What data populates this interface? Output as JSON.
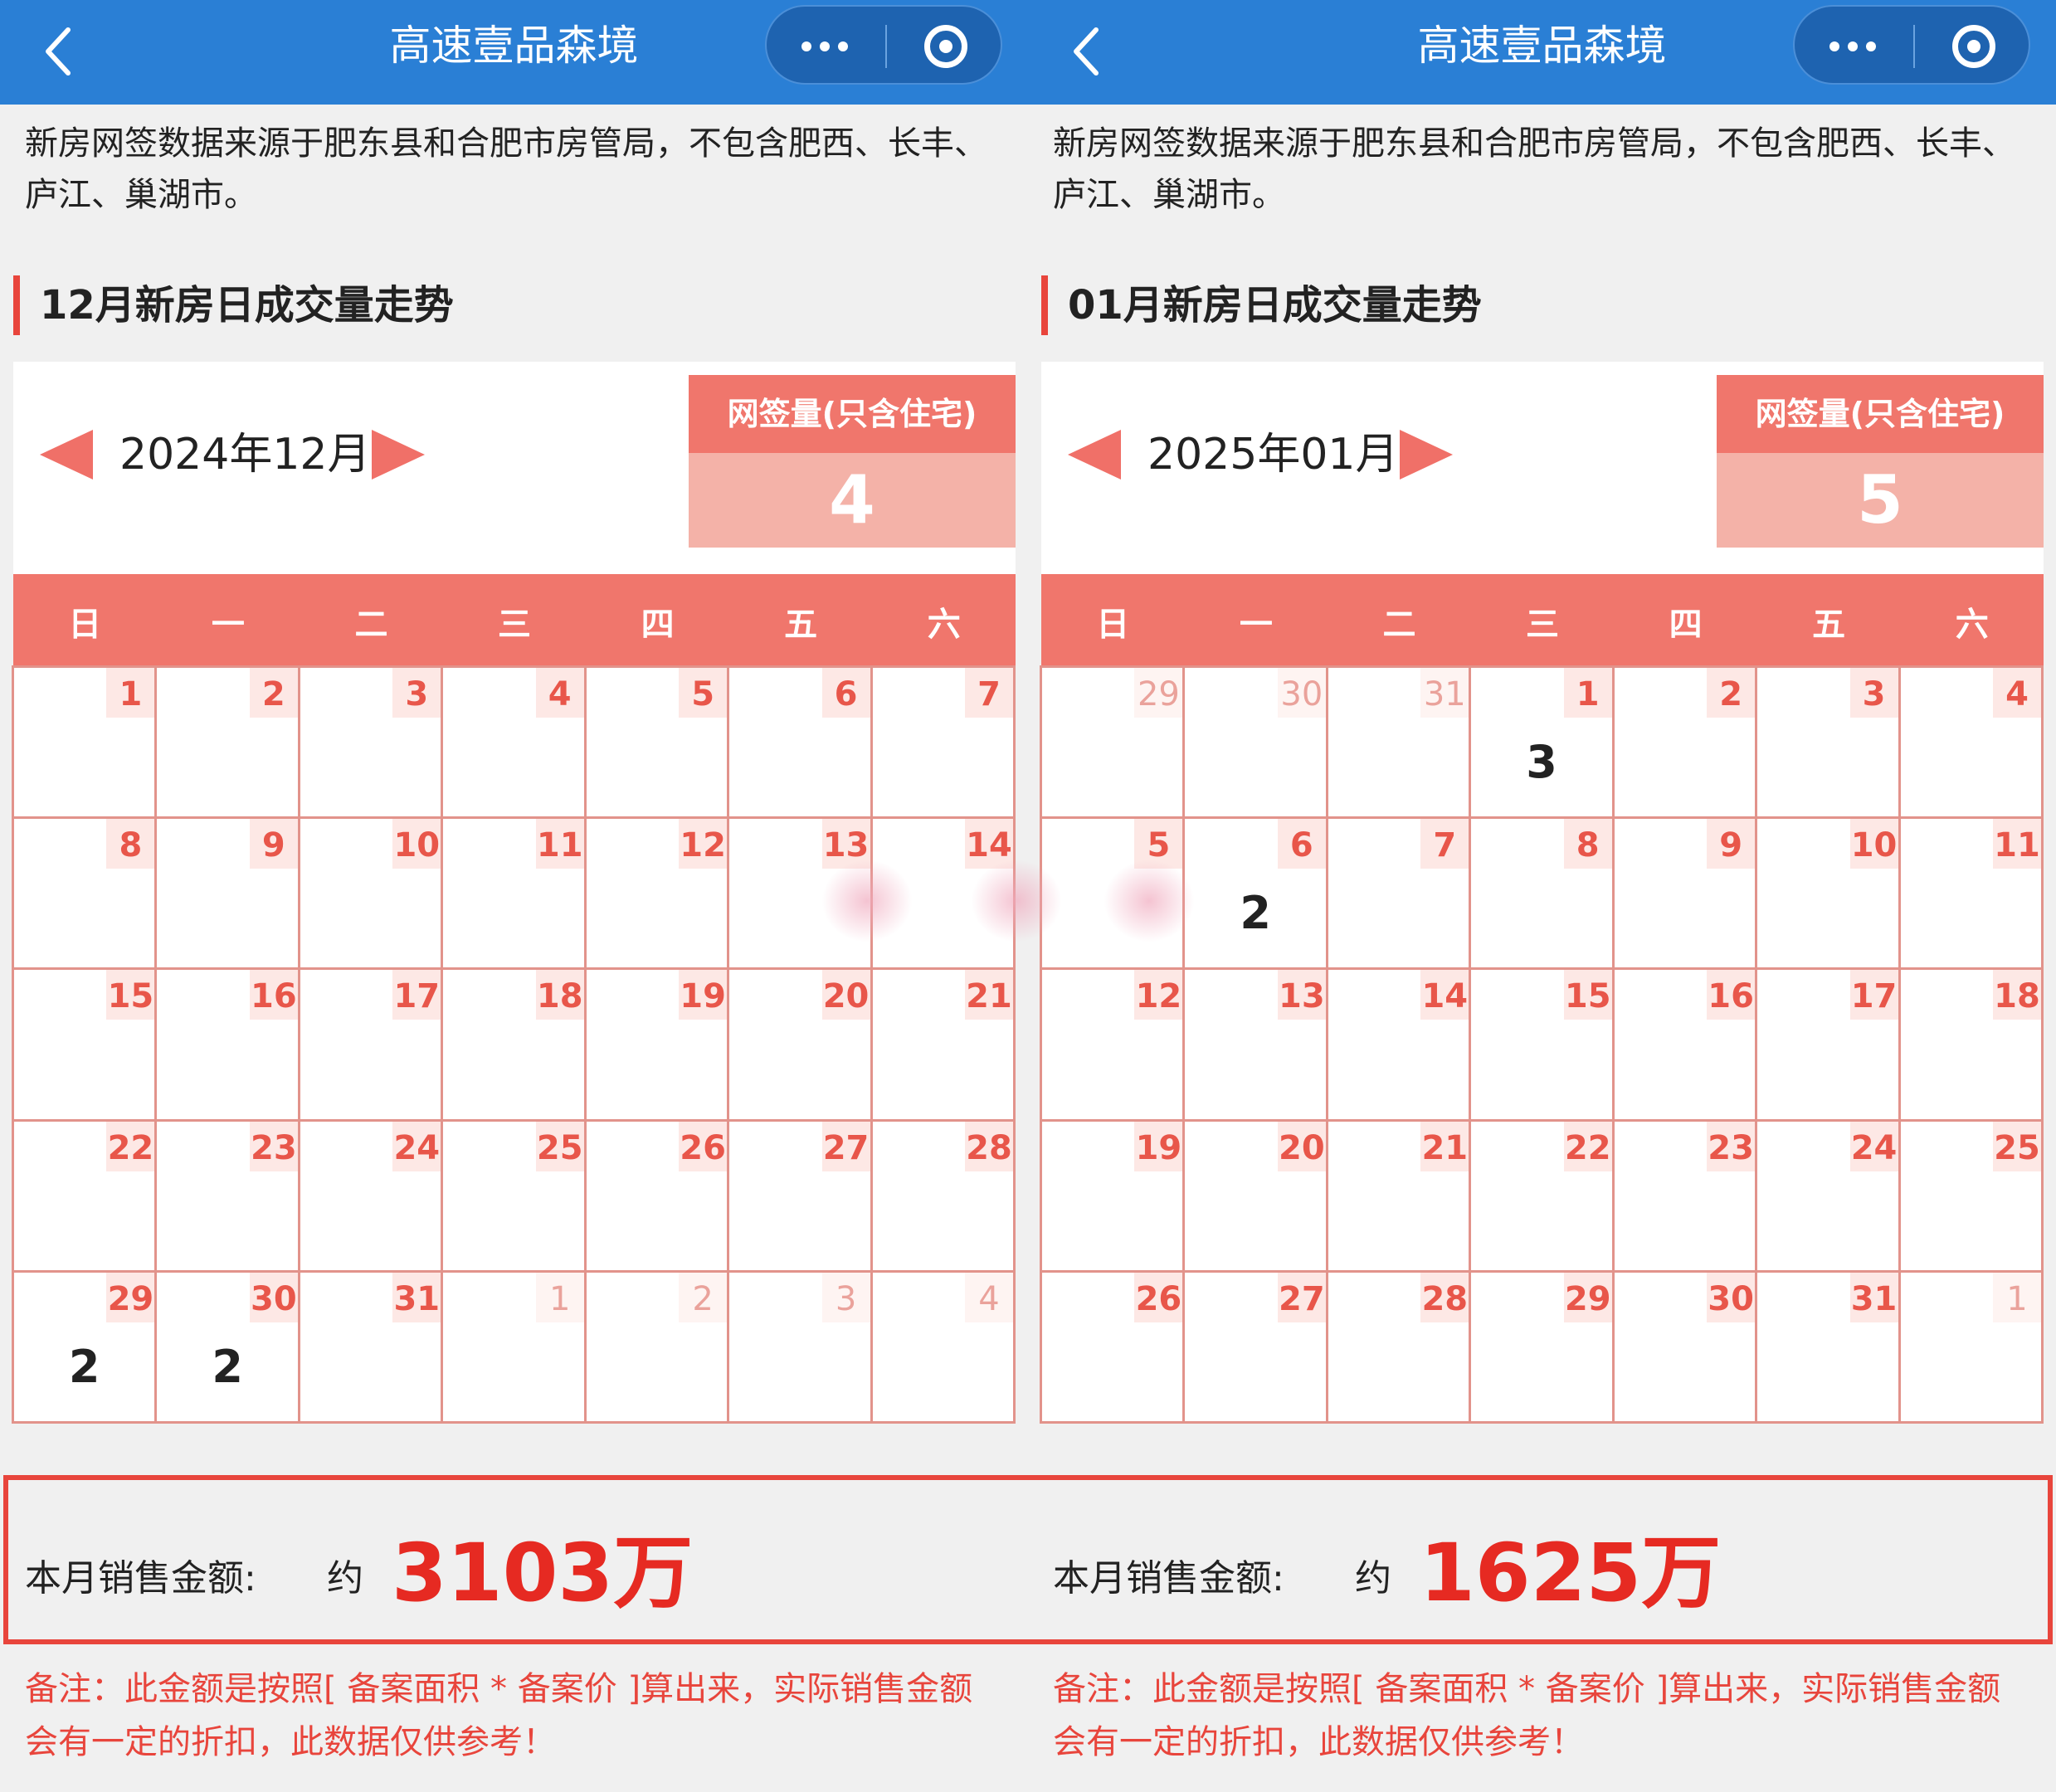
{
  "panels": [
    {
      "app_title": "高速壹品森境",
      "intro": "新房网签数据来源于肥东县和合肥市房管局，不包含肥西、长丰、庐江、巢湖市。",
      "section_title": "12月新房日成交量走势",
      "month_label": "2024年12月",
      "sign_label": "网签量(只含住宅)",
      "sign_value": "4",
      "weekdays": [
        "日",
        "一",
        "二",
        "三",
        "四",
        "五",
        "六"
      ],
      "days": [
        {
          "d": "1"
        },
        {
          "d": "2"
        },
        {
          "d": "3"
        },
        {
          "d": "4"
        },
        {
          "d": "5"
        },
        {
          "d": "6"
        },
        {
          "d": "7"
        },
        {
          "d": "8"
        },
        {
          "d": "9"
        },
        {
          "d": "10"
        },
        {
          "d": "11"
        },
        {
          "d": "12"
        },
        {
          "d": "13"
        },
        {
          "d": "14"
        },
        {
          "d": "15"
        },
        {
          "d": "16"
        },
        {
          "d": "17"
        },
        {
          "d": "18"
        },
        {
          "d": "19"
        },
        {
          "d": "20"
        },
        {
          "d": "21"
        },
        {
          "d": "22"
        },
        {
          "d": "23"
        },
        {
          "d": "24"
        },
        {
          "d": "25"
        },
        {
          "d": "26"
        },
        {
          "d": "27"
        },
        {
          "d": "28"
        },
        {
          "d": "29",
          "count": "2"
        },
        {
          "d": "30",
          "count": "2"
        },
        {
          "d": "31"
        },
        {
          "d": "1",
          "other": true
        },
        {
          "d": "2",
          "other": true
        },
        {
          "d": "3",
          "other": true
        },
        {
          "d": "4",
          "other": true
        }
      ],
      "sales_label": "本月销售金额:",
      "sales_approx": "约",
      "sales_value": "3103万",
      "note": "备注：此金额是按照[ 备案面积 * 备案价 ]算出来，实际销售金额会有一定的折扣，此数据仅供参考！"
    },
    {
      "app_title": "高速壹品森境",
      "intro": "新房网签数据来源于肥东县和合肥市房管局，不包含肥西、长丰、庐江、巢湖市。",
      "section_title": "01月新房日成交量走势",
      "month_label": "2025年01月",
      "sign_label": "网签量(只含住宅)",
      "sign_value": "5",
      "weekdays": [
        "日",
        "一",
        "二",
        "三",
        "四",
        "五",
        "六"
      ],
      "days": [
        {
          "d": "29",
          "other": true
        },
        {
          "d": "30",
          "other": true
        },
        {
          "d": "31",
          "other": true
        },
        {
          "d": "1",
          "count": "3"
        },
        {
          "d": "2"
        },
        {
          "d": "3"
        },
        {
          "d": "4"
        },
        {
          "d": "5"
        },
        {
          "d": "6",
          "count": "2"
        },
        {
          "d": "7"
        },
        {
          "d": "8"
        },
        {
          "d": "9"
        },
        {
          "d": "10"
        },
        {
          "d": "11"
        },
        {
          "d": "12"
        },
        {
          "d": "13"
        },
        {
          "d": "14"
        },
        {
          "d": "15"
        },
        {
          "d": "16"
        },
        {
          "d": "17"
        },
        {
          "d": "18"
        },
        {
          "d": "19"
        },
        {
          "d": "20"
        },
        {
          "d": "21"
        },
        {
          "d": "22"
        },
        {
          "d": "23"
        },
        {
          "d": "24"
        },
        {
          "d": "25"
        },
        {
          "d": "26"
        },
        {
          "d": "27"
        },
        {
          "d": "28"
        },
        {
          "d": "29"
        },
        {
          "d": "30"
        },
        {
          "d": "31"
        },
        {
          "d": "1",
          "other": true
        }
      ],
      "sales_label": "本月销售金额:",
      "sales_approx": "约",
      "sales_value": "1625万",
      "note": "备注：此金额是按照[ 备案面积 * 备案价 ]算出来，实际销售金额会有一定的折扣，此数据仅供参考！"
    }
  ],
  "colors": {
    "topbar": "#2a7fd5",
    "accent": "#f0766c",
    "sales_value": "#e62a22",
    "note": "#e8453c"
  },
  "icons": [
    "back-arrow-icon",
    "more-dots-icon",
    "target-icon",
    "prev-month-icon",
    "next-month-icon"
  ]
}
